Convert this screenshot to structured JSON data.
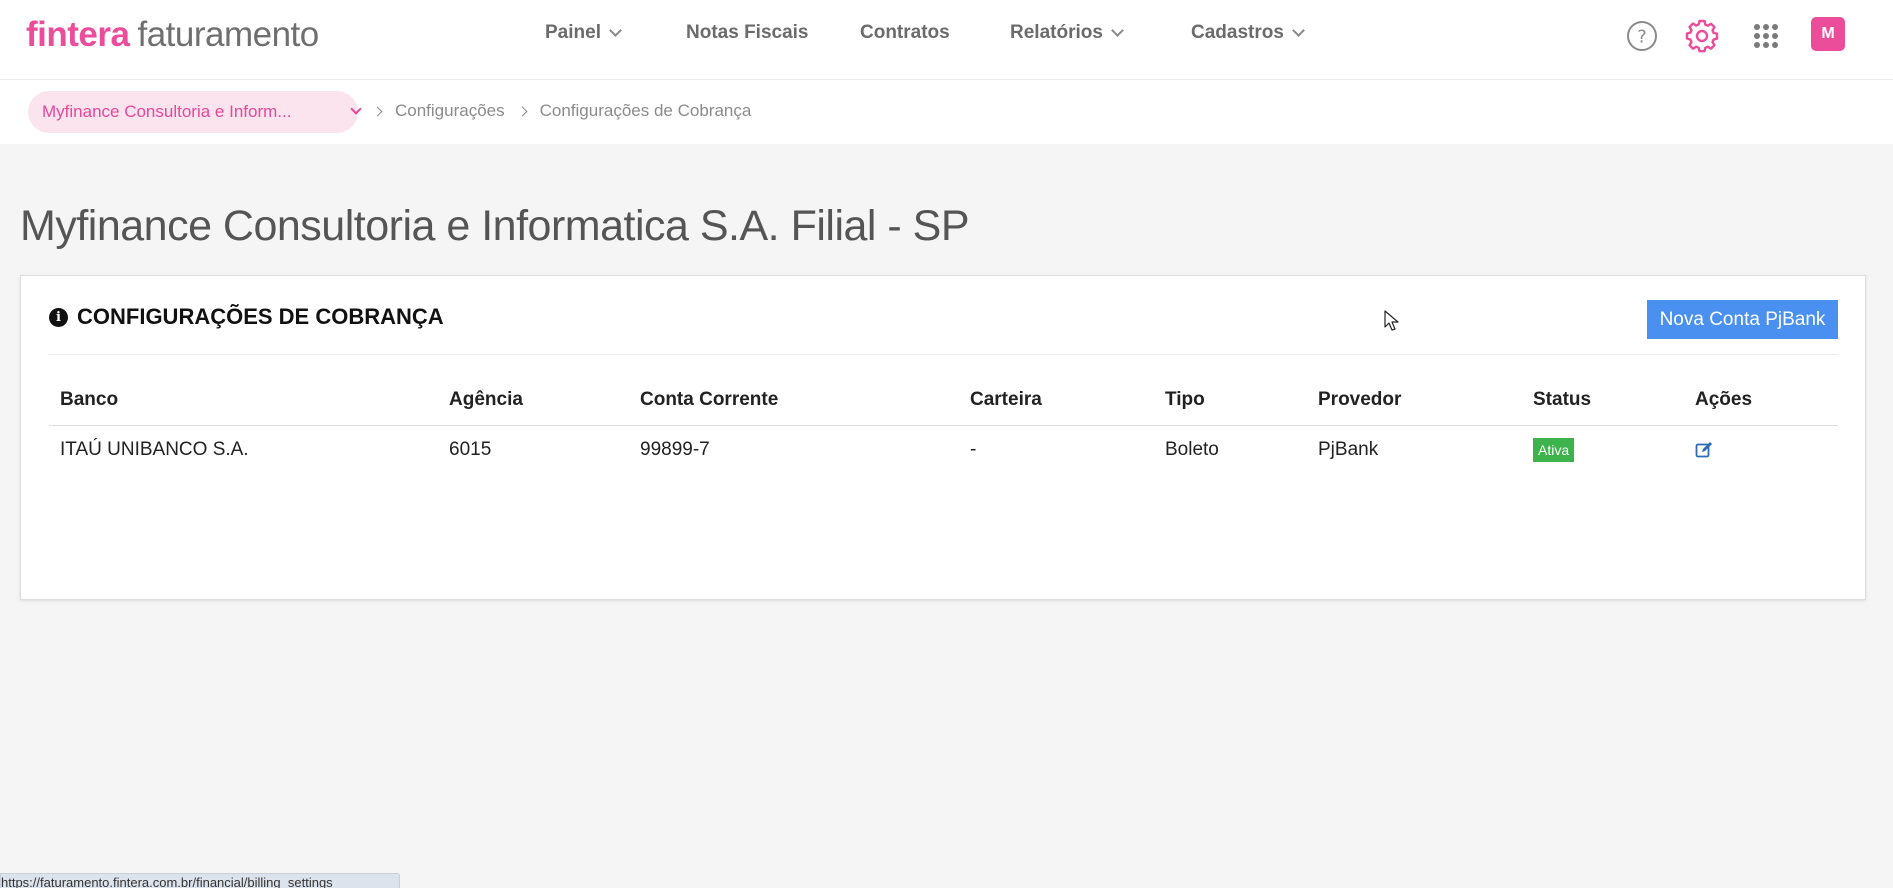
{
  "brand": {
    "part1": "fintera",
    "part2": "faturamento"
  },
  "nav": {
    "painel": "Painel",
    "notas_fiscais": "Notas Fiscais",
    "contratos": "Contratos",
    "relatorios": "Relatórios",
    "cadastros": "Cadastros"
  },
  "header_icons": [
    "help-icon",
    "gear-icon",
    "apps-grid-icon"
  ],
  "user": {
    "initial": "M"
  },
  "breadcrumb": {
    "company": "Myfinance Consultoria e Inform...",
    "items": [
      "Configurações",
      "Configurações de Cobrança"
    ]
  },
  "page": {
    "title": "Myfinance Consultoria e Informatica S.A. Filial - SP"
  },
  "card": {
    "title": "CONFIGURAÇÕES DE COBRANÇA",
    "new_button": "Nova Conta PjBank"
  },
  "table": {
    "headers": [
      "Banco",
      "Agência",
      "Conta Corrente",
      "Carteira",
      "Tipo",
      "Provedor",
      "Status",
      "Ações"
    ],
    "rows": [
      {
        "banco": "ITAÚ UNIBANCO S.A.",
        "agencia": "6015",
        "conta": "99899-7",
        "carteira": "-",
        "tipo": "Boleto",
        "provedor": "PjBank",
        "status": "Ativa"
      }
    ]
  },
  "status_bar": {
    "url": "https://faturamento.fintera.com.br/financial/billing_settings"
  },
  "colors": {
    "brand_pink": "#ec4d9a",
    "button_blue": "#4a90f0",
    "status_green": "#3cb44b"
  }
}
